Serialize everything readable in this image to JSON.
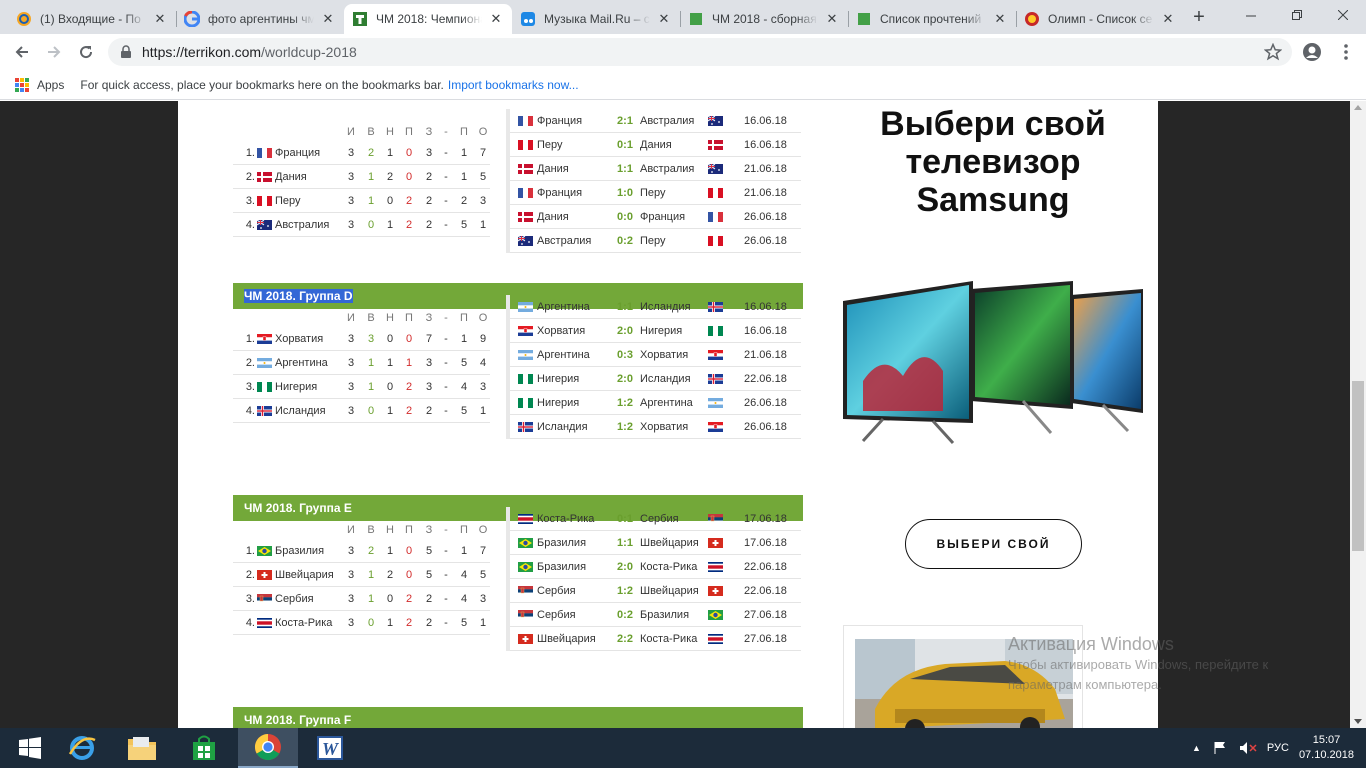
{
  "browser": {
    "tabs": [
      {
        "title": "(1) Входящие - По",
        "icon": "mail-ru-icon",
        "active": false
      },
      {
        "title": "фото аргентины чм",
        "icon": "google-icon",
        "active": false
      },
      {
        "title": "ЧМ 2018: Чемпионат",
        "icon": "terrikon-icon",
        "active": true
      },
      {
        "title": "Музыка Mail.Ru – с",
        "icon": "music-icon",
        "active": false
      },
      {
        "title": "ЧМ 2018 - сборная",
        "icon": "green-square-icon",
        "active": false
      },
      {
        "title": "Список прочтений",
        "icon": "green-square-icon",
        "active": false
      },
      {
        "title": "Олимп - Список се",
        "icon": "olimp-icon",
        "active": false
      }
    ],
    "url_host": "https://terrikon.com",
    "url_path": "/worldcup-2018",
    "bookmarks": {
      "apps_label": "Apps",
      "hint": "For quick access, place your bookmarks here on the bookmarks bar.",
      "import_link": "Import bookmarks now..."
    }
  },
  "standings_header": [
    "И",
    "В",
    "Н",
    "П",
    "З",
    "-",
    "П",
    "О"
  ],
  "colors": {
    "group_header": "#73a839",
    "selection": "#3367d6",
    "green_text": "#6a9f2e",
    "red_text": "#d22c2c"
  },
  "groups": [
    {
      "title": "",
      "standings": [
        {
          "pos": "1.",
          "team": "Франция",
          "flag": "france",
          "i": "3",
          "v": "2",
          "n": "1",
          "p": "0",
          "z": "3",
          "pr": "1",
          "o": "7"
        },
        {
          "pos": "2.",
          "team": "Дания",
          "flag": "denmark",
          "i": "3",
          "v": "1",
          "n": "2",
          "p": "0",
          "z": "2",
          "pr": "1",
          "o": "5"
        },
        {
          "pos": "3.",
          "team": "Перу",
          "flag": "peru",
          "i": "3",
          "v": "1",
          "n": "0",
          "p": "2",
          "z": "2",
          "pr": "2",
          "o": "3"
        },
        {
          "pos": "4.",
          "team": "Австралия",
          "flag": "australia",
          "i": "3",
          "v": "0",
          "n": "1",
          "p": "2",
          "z": "2",
          "pr": "5",
          "o": "1"
        }
      ],
      "matches": [
        {
          "home": "Франция",
          "hflag": "france",
          "score": "2:1",
          "away": "Австралия",
          "aflag": "australia",
          "date": "16.06.18"
        },
        {
          "home": "Перу",
          "hflag": "peru",
          "score": "0:1",
          "away": "Дания",
          "aflag": "denmark",
          "date": "16.06.18"
        },
        {
          "home": "Дания",
          "hflag": "denmark",
          "score": "1:1",
          "away": "Австралия",
          "aflag": "australia",
          "date": "21.06.18"
        },
        {
          "home": "Франция",
          "hflag": "france",
          "score": "1:0",
          "away": "Перу",
          "aflag": "peru",
          "date": "21.06.18"
        },
        {
          "home": "Дания",
          "hflag": "denmark",
          "score": "0:0",
          "away": "Франция",
          "aflag": "france",
          "date": "26.06.18"
        },
        {
          "home": "Австралия",
          "hflag": "australia",
          "score": "0:2",
          "away": "Перу",
          "aflag": "peru",
          "date": "26.06.18"
        }
      ]
    },
    {
      "title": "ЧМ 2018. Группа D",
      "selected": true,
      "standings": [
        {
          "pos": "1.",
          "team": "Хорватия",
          "flag": "croatia",
          "i": "3",
          "v": "3",
          "n": "0",
          "p": "0",
          "z": "7",
          "pr": "1",
          "o": "9"
        },
        {
          "pos": "2.",
          "team": "Аргентина",
          "flag": "argentina",
          "i": "3",
          "v": "1",
          "n": "1",
          "p": "1",
          "z": "3",
          "pr": "5",
          "o": "4"
        },
        {
          "pos": "3.",
          "team": "Нигерия",
          "flag": "nigeria",
          "i": "3",
          "v": "1",
          "n": "0",
          "p": "2",
          "z": "3",
          "pr": "4",
          "o": "3"
        },
        {
          "pos": "4.",
          "team": "Исландия",
          "flag": "iceland",
          "i": "3",
          "v": "0",
          "n": "1",
          "p": "2",
          "z": "2",
          "pr": "5",
          "o": "1"
        }
      ],
      "matches": [
        {
          "home": "Аргентина",
          "hflag": "argentina",
          "score": "1:1",
          "away": "Исландия",
          "aflag": "iceland",
          "date": "16.06.18"
        },
        {
          "home": "Хорватия",
          "hflag": "croatia",
          "score": "2:0",
          "away": "Нигерия",
          "aflag": "nigeria",
          "date": "16.06.18"
        },
        {
          "home": "Аргентина",
          "hflag": "argentina",
          "score": "0:3",
          "away": "Хорватия",
          "aflag": "croatia",
          "date": "21.06.18"
        },
        {
          "home": "Нигерия",
          "hflag": "nigeria",
          "score": "2:0",
          "away": "Исландия",
          "aflag": "iceland",
          "date": "22.06.18"
        },
        {
          "home": "Нигерия",
          "hflag": "nigeria",
          "score": "1:2",
          "away": "Аргентина",
          "aflag": "argentina",
          "date": "26.06.18"
        },
        {
          "home": "Исландия",
          "hflag": "iceland",
          "score": "1:2",
          "away": "Хорватия",
          "aflag": "croatia",
          "date": "26.06.18"
        }
      ]
    },
    {
      "title": "ЧМ 2018. Группа E",
      "standings": [
        {
          "pos": "1.",
          "team": "Бразилия",
          "flag": "brazil",
          "i": "3",
          "v": "2",
          "n": "1",
          "p": "0",
          "z": "5",
          "pr": "1",
          "o": "7"
        },
        {
          "pos": "2.",
          "team": "Швейцария",
          "flag": "switzerland",
          "i": "3",
          "v": "1",
          "n": "2",
          "p": "0",
          "z": "5",
          "pr": "4",
          "o": "5"
        },
        {
          "pos": "3.",
          "team": "Сербия",
          "flag": "serbia",
          "i": "3",
          "v": "1",
          "n": "0",
          "p": "2",
          "z": "2",
          "pr": "4",
          "o": "3"
        },
        {
          "pos": "4.",
          "team": "Коста-Рика",
          "flag": "costarica",
          "i": "3",
          "v": "0",
          "n": "1",
          "p": "2",
          "z": "2",
          "pr": "5",
          "o": "1"
        }
      ],
      "matches": [
        {
          "home": "Коста-Рика",
          "hflag": "costarica",
          "score": "0:1",
          "away": "Сербия",
          "aflag": "serbia",
          "date": "17.06.18"
        },
        {
          "home": "Бразилия",
          "hflag": "brazil",
          "score": "1:1",
          "away": "Швейцария",
          "aflag": "switzerland",
          "date": "17.06.18"
        },
        {
          "home": "Бразилия",
          "hflag": "brazil",
          "score": "2:0",
          "away": "Коста-Рика",
          "aflag": "costarica",
          "date": "22.06.18"
        },
        {
          "home": "Сербия",
          "hflag": "serbia",
          "score": "1:2",
          "away": "Швейцария",
          "aflag": "switzerland",
          "date": "22.06.18"
        },
        {
          "home": "Сербия",
          "hflag": "serbia",
          "score": "0:2",
          "away": "Бразилия",
          "aflag": "brazil",
          "date": "27.06.18"
        },
        {
          "home": "Швейцария",
          "hflag": "switzerland",
          "score": "2:2",
          "away": "Коста-Рика",
          "aflag": "costarica",
          "date": "27.06.18"
        }
      ]
    },
    {
      "title": "ЧМ 2018. Группа F",
      "standings": [],
      "matches": []
    }
  ],
  "ad": {
    "title_line1": "Выбери свой",
    "title_line2": "телевизор",
    "title_line3": "Samsung",
    "button": "ВЫБЕРИ СВОЙ"
  },
  "windows_activation": {
    "line1": "Активация Windows",
    "line2": "Чтобы активировать Windows, перейдите к",
    "line3": "параметрам компьютера."
  },
  "taskbar": {
    "language": "РУС",
    "time": "15:07",
    "date": "07.10.2018"
  }
}
